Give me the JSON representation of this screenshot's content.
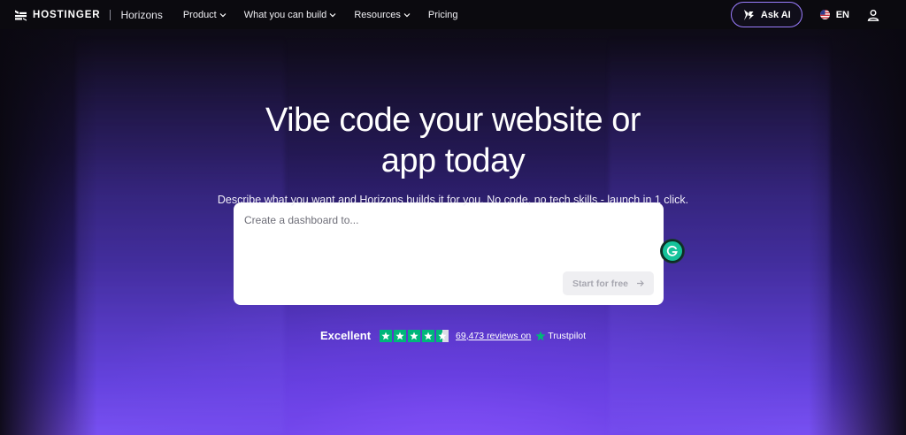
{
  "nav": {
    "brand": "HOSTINGER",
    "product": "Horizons",
    "menu": [
      {
        "label": "Product",
        "dropdown": true
      },
      {
        "label": "What you can build",
        "dropdown": true
      },
      {
        "label": "Resources",
        "dropdown": true
      },
      {
        "label": "Pricing",
        "dropdown": false
      }
    ],
    "ask_ai": "Ask AI",
    "language": "EN"
  },
  "hero": {
    "headline_line1": "Vibe code your website or",
    "headline_line2": "app today",
    "subtitle": "Describe what you want and Horizons builds it for you. No code, no tech skills - launch in 1 click."
  },
  "prompt": {
    "placeholder": "Create a dashboard to...",
    "value": "",
    "button_label": "Start for free"
  },
  "trust": {
    "rating_word": "Excellent",
    "stars": 4.5,
    "reviews_text": "69,473 reviews on",
    "provider": "Trustpilot"
  },
  "colors": {
    "accent": "#9b7dff",
    "trustpilot_green": "#00b67a",
    "grammarly_green": "#15c39a",
    "background_dark": "#0b0a0f",
    "hero_purple": "#7a4ff5"
  },
  "icons": [
    "hostinger-logo-icon",
    "chevron-down-icon",
    "ask-ai-icon",
    "us-flag-icon",
    "user-icon",
    "arrow-right-icon",
    "grammarly-icon",
    "star-icon",
    "trustpilot-star-icon"
  ]
}
